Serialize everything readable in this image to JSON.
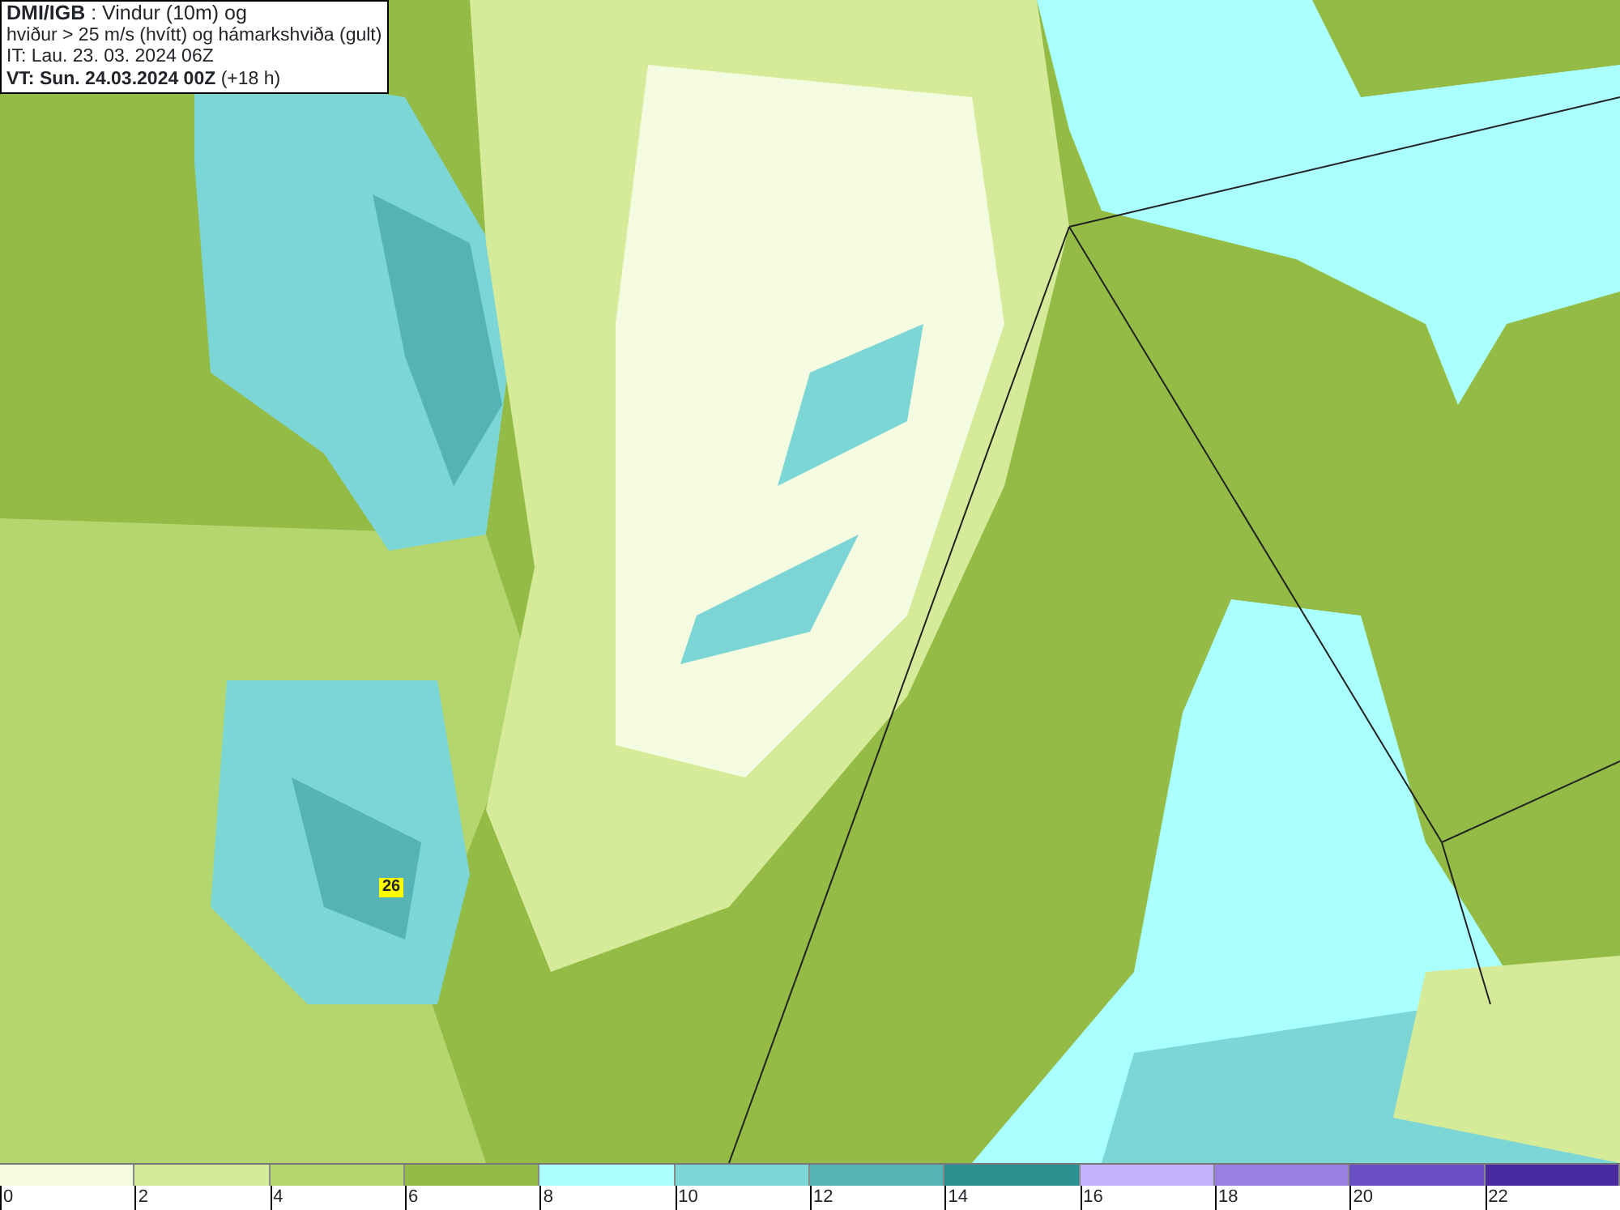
{
  "title_box": {
    "lines": [
      "**DMI/IGB** : Vindur (10m) og",
      "hviður > 25 m/s (hvítt) og hámarkshviða (gult)",
      "IT: Lau. 23. 03. 2024 06Z",
      "**VT: Sun. 24.03.2024 00Z** (+18 h)"
    ]
  },
  "map": {
    "gust_labels": [
      "26"
    ]
  },
  "legend": {
    "segments": [
      {
        "color": "#f5fbe0"
      },
      {
        "color": "#d6eb9a"
      },
      {
        "color": "#b5d66e"
      },
      {
        "color": "#93bb45"
      },
      {
        "color": "#aaffff"
      },
      {
        "color": "#7dd6d6"
      },
      {
        "color": "#55b3b3"
      },
      {
        "color": "#2a9090"
      },
      {
        "color": "#c3b3ff"
      },
      {
        "color": "#9980e0"
      },
      {
        "color": "#6a4fc4"
      },
      {
        "color": "#4a2aa0"
      }
    ],
    "labels": [
      "0",
      "2",
      "4",
      "6",
      "8",
      "10",
      "12",
      "14",
      "16",
      "18",
      "20",
      "22"
    ]
  }
}
